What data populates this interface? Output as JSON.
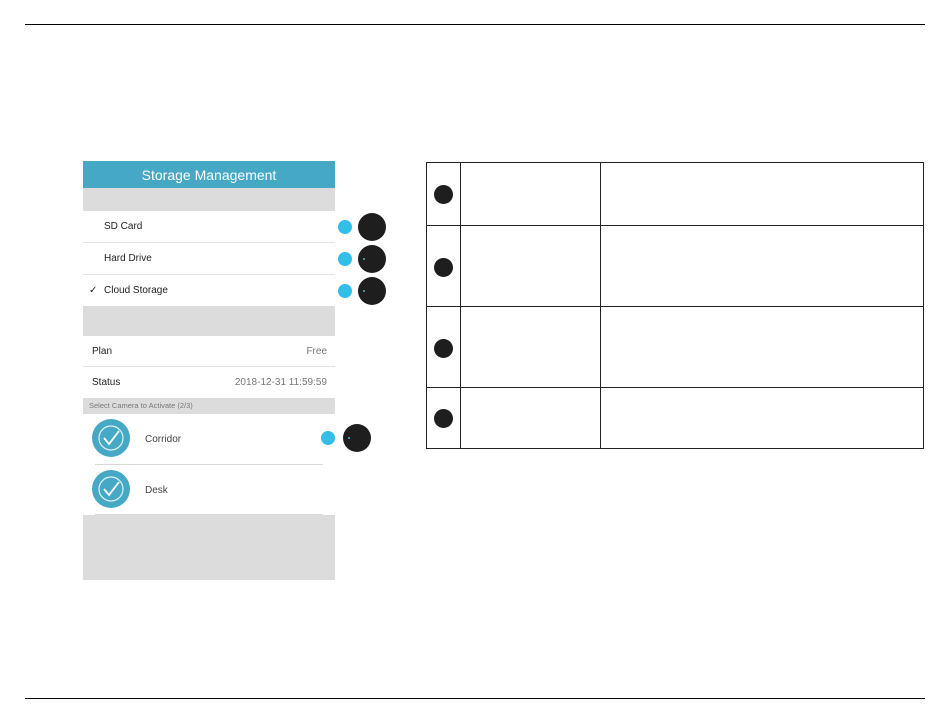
{
  "storage": {
    "title": "Storage Management",
    "options": [
      {
        "label": "SD Card",
        "selected": false
      },
      {
        "label": "Hard Drive",
        "selected": false
      },
      {
        "label": "Cloud Storage",
        "selected": true
      }
    ],
    "check_mark": "✓",
    "plan_label": "Plan",
    "plan_value": "Free",
    "status_label": "Status",
    "status_value": "2018-12-31 11:59:59",
    "camera_section_label": "Select Camera to Activate (2/3)",
    "cameras": [
      {
        "name": "Corridor"
      },
      {
        "name": "Desk"
      }
    ]
  },
  "colors": {
    "accent": "#45a9c6",
    "callout_blue": "#35bde9",
    "callout_dark": "#1e1e1e",
    "gap_gray": "#dcdcdc"
  },
  "icons": {
    "camera_avatar": "checkmark-circle-icon",
    "selected_option": "check-icon"
  }
}
